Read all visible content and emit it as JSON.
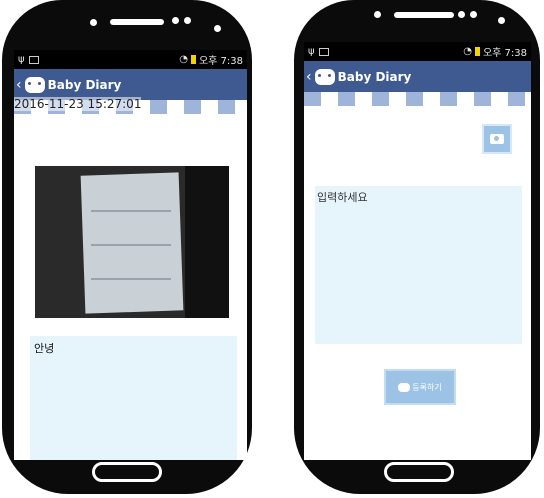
{
  "left_screen": {
    "status": {
      "right_text": "오후 7:38"
    },
    "appbar": {
      "title": "Baby Diary"
    },
    "entry": {
      "datetime": "2016-11-23 15:27:01",
      "memo": "안녕"
    }
  },
  "right_screen": {
    "status": {
      "right_text": "오후 7:38"
    },
    "appbar": {
      "title": "Baby Diary"
    },
    "form": {
      "placeholder": "입력하세요",
      "submit_label": "등록하기"
    }
  },
  "colors": {
    "appbar": "#3e5a91",
    "input_bg": "#e6f5fc",
    "button": "#9cc3e6",
    "status_bar": "#000000"
  },
  "icons": [
    "usb-icon",
    "image-icon",
    "wifi-icon",
    "battery-icon",
    "back-chevron-icon",
    "baby-logo-icon",
    "camera-icon"
  ]
}
